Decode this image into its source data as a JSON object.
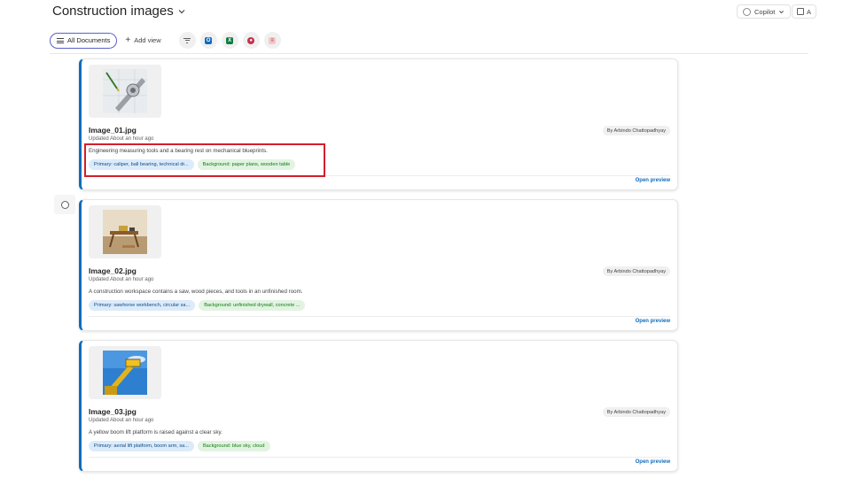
{
  "header": {
    "title": "Construction images",
    "copilot_label": "Copilot",
    "share_label": "A"
  },
  "toolbar": {
    "all_documents_label": "All Documents",
    "add_view_label": "Add view",
    "icons": [
      "filter-icon",
      "outlook-icon",
      "excel-icon",
      "powerapps-icon",
      "forms-icon"
    ]
  },
  "cards": [
    {
      "filename": "Image_01.jpg",
      "updated": "Updated About an hour ago",
      "description": "Engineering measuring tools and a bearing rest on mechanical blueprints.",
      "primary_tag": "Primary: caliper, ball bearing, technical dr...",
      "background_tag": "Background: paper plans, wooden table",
      "author": "By Arbindo Chattopadhyay",
      "open_preview": "Open preview"
    },
    {
      "filename": "Image_02.jpg",
      "updated": "Updated About an hour ago",
      "description": "A construction workspace contains a saw, wood pieces, and tools in an unfinished room.",
      "primary_tag": "Primary: sawhorse workbench, circular sa...",
      "background_tag": "Background: unfinished drywall, concrete ...",
      "author": "By Arbindo Chattopadhyay",
      "open_preview": "Open preview"
    },
    {
      "filename": "Image_03.jpg",
      "updated": "Updated About an hour ago",
      "description": "A yellow boom lift platform is raised against a clear sky.",
      "primary_tag": "Primary: aerial lift platform, boom arm, sa...",
      "background_tag": "Background: blue sky, cloud",
      "author": "By Arbindo Chattopadhyay",
      "open_preview": "Open preview"
    }
  ],
  "colors": {
    "accent": "#0f6cbd",
    "highlight": "#d21f2b",
    "primary_tag_bg": "#dcebfa",
    "background_tag_bg": "#e2f3e2"
  }
}
